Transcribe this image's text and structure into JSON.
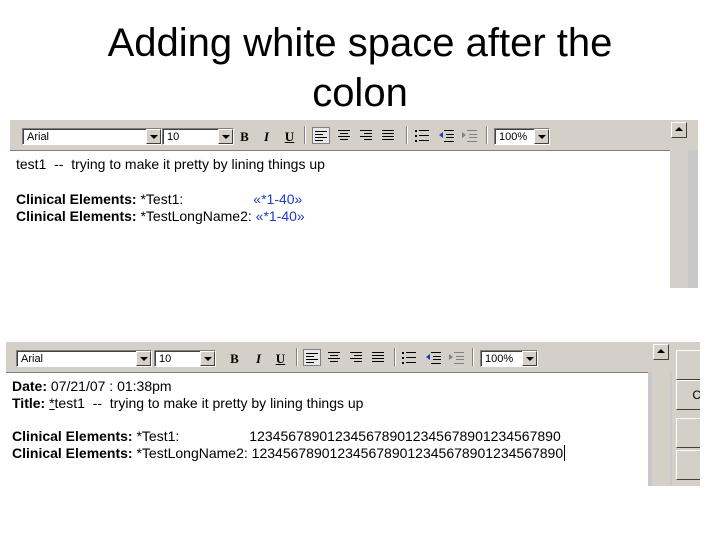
{
  "slide": {
    "title_line1": "Adding white space after the",
    "title_line2": "colon"
  },
  "top": {
    "toolbar": {
      "font": "Arial",
      "size": "10",
      "bold": "B",
      "italic": "I",
      "underline": "U",
      "zoom": "100%"
    },
    "lines": {
      "line1": "test1  --  trying to make it pretty by lining things up",
      "row1_label": "Clinical Elements:",
      "row1_name": " *Test1:                  ",
      "row1_value": "«*1-40»",
      "row2_label": "Clinical Elements:",
      "row2_name": " *TestLongName2: ",
      "row2_value": "«*1-40»"
    }
  },
  "bottom": {
    "toolbar": {
      "font": "Arial",
      "size": "10",
      "bold": "B",
      "italic": "I",
      "underline": "U",
      "zoom": "100%"
    },
    "lines": {
      "date_label": "Date:",
      "date_value": " 07/21/07 : 01:38pm",
      "title_label": "Title:",
      "title_star": "*",
      "title_rest": "test1  --  trying to make it pretty by lining things up",
      "row1_label": "Clinical Elements:",
      "row1_name": " *Test1:                  ",
      "row1_value": "1234567890123456789012345678901234567890",
      "row2_label": "Clinical Elements:",
      "row2_name": " *TestLongName2: ",
      "row2_value": "1234567890123456789012345678901234567890"
    },
    "side_button_label": "C"
  }
}
